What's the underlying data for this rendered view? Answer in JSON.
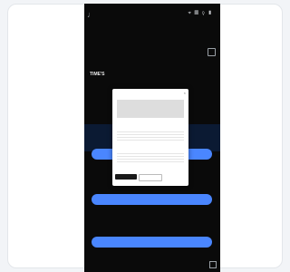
{
  "phone": {
    "status_icons": "⌖ ▦ ⚲ ▮",
    "heading": "TIME'S",
    "body_text": "",
    "section_label": "",
    "blue_button_1": "",
    "blue_button_2": "",
    "blue_button_3": "",
    "caption": "",
    "caption_2": ""
  },
  "modal": {
    "title": "",
    "close": "×",
    "heading_1": "",
    "heading_2": "",
    "btn_left": "",
    "btn_mid": "",
    "btn_right": "",
    "footer": ""
  }
}
